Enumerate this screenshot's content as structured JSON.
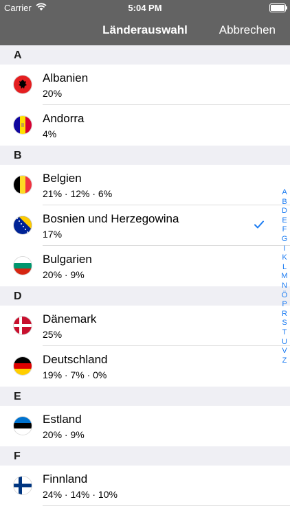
{
  "status": {
    "carrier": "Carrier",
    "time": "5:04 PM"
  },
  "nav": {
    "title": "Länderauswahl",
    "cancel": "Abbrechen"
  },
  "sections": [
    {
      "letter": "A",
      "rows": [
        {
          "name": "Albanien",
          "vat": "20%",
          "flag": "albania-flag-icon"
        },
        {
          "name": "Andorra",
          "vat": "4%",
          "flag": "andorra-flag-icon"
        }
      ]
    },
    {
      "letter": "B",
      "rows": [
        {
          "name": "Belgien",
          "vat": "21% · 12% · 6%",
          "flag": "belgium-flag-icon"
        },
        {
          "name": "Bosnien und Herzegowina",
          "vat": "17%",
          "flag": "bosnia-flag-icon",
          "selected": true
        },
        {
          "name": "Bulgarien",
          "vat": "20% · 9%",
          "flag": "bulgaria-flag-icon"
        }
      ]
    },
    {
      "letter": "D",
      "rows": [
        {
          "name": "Dänemark",
          "vat": "25%",
          "flag": "denmark-flag-icon"
        },
        {
          "name": "Deutschland",
          "vat": "19% · 7% · 0%",
          "flag": "germany-flag-icon"
        }
      ]
    },
    {
      "letter": "E",
      "rows": [
        {
          "name": "Estland",
          "vat": "20% · 9%",
          "flag": "estonia-flag-icon"
        }
      ]
    },
    {
      "letter": "F",
      "rows": [
        {
          "name": "Finnland",
          "vat": "24% · 14% · 10%",
          "flag": "finland-flag-icon"
        }
      ]
    }
  ],
  "index": [
    "A",
    "B",
    "D",
    "E",
    "F",
    "G",
    "I",
    "K",
    "L",
    "M",
    "N",
    "Ö",
    "P",
    "R",
    "S",
    "T",
    "U",
    "V",
    "Z"
  ],
  "colors": {
    "nav_bg": "#636363",
    "section_bg": "#efeff4",
    "accent": "#1a7bf2"
  }
}
